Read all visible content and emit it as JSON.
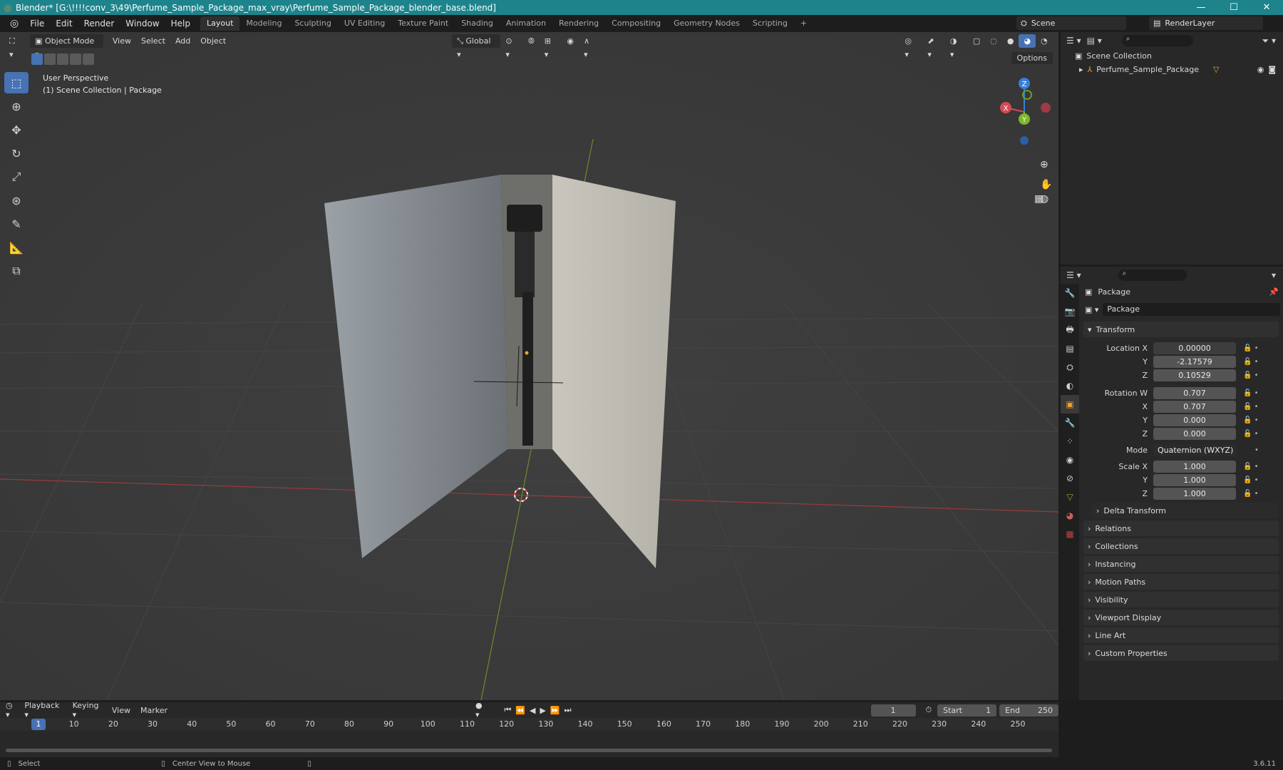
{
  "window": {
    "title": "Blender* [G:\\!!!!conv_3\\49\\Perfume_Sample_Package_max_vray\\Perfume_Sample_Package_blender_base.blend]",
    "min": "—",
    "max": "☐",
    "close": "✕"
  },
  "menu": [
    "File",
    "Edit",
    "Render",
    "Window",
    "Help"
  ],
  "workspaces": [
    "Layout",
    "Modeling",
    "Sculpting",
    "UV Editing",
    "Texture Paint",
    "Shading",
    "Animation",
    "Rendering",
    "Compositing",
    "Geometry Nodes",
    "Scripting",
    "+"
  ],
  "scene": {
    "name": "Scene",
    "view_layer": "RenderLayer"
  },
  "viewport": {
    "mode": "Object Mode",
    "menus": [
      "View",
      "Select",
      "Add",
      "Object"
    ],
    "orientation": "Global",
    "options": "Options",
    "info_line1": "User Perspective",
    "info_line2": "(1) Scene Collection | Package",
    "gizmo": {
      "x": "X",
      "y": "Y",
      "z": "Z"
    }
  },
  "outliner": {
    "root": "Scene Collection",
    "item": "Perfume_Sample_Package"
  },
  "properties": {
    "object_name": "Package",
    "data_name": "Package",
    "transform_label": "Transform",
    "location": {
      "label": "Location X",
      "x": "0.00000",
      "y": "-2.17579",
      "z": "0.10529"
    },
    "rotation": {
      "label": "Rotation W",
      "w": "0.707",
      "x": "0.707",
      "y": "0.000",
      "z": "0.000"
    },
    "mode_label": "Mode",
    "mode_value": "Quaternion (WXYZ)",
    "scale": {
      "label": "Scale X",
      "x": "1.000",
      "y": "1.000",
      "z": "1.000"
    },
    "axis_y": "Y",
    "axis_z": "Z",
    "axis_x": "X",
    "delta": "Delta Transform",
    "panels": [
      "Relations",
      "Collections",
      "Instancing",
      "Motion Paths",
      "Visibility",
      "Viewport Display",
      "Line Art",
      "Custom Properties"
    ]
  },
  "timeline": {
    "menus": [
      "Playback",
      "Keying",
      "View",
      "Marker"
    ],
    "current_frame": "1",
    "start_label": "Start",
    "start": "1",
    "end_label": "End",
    "end": "250",
    "ticks": [
      "1",
      "10",
      "20",
      "30",
      "40",
      "50",
      "60",
      "70",
      "80",
      "90",
      "100",
      "110",
      "120",
      "130",
      "140",
      "150",
      "160",
      "170",
      "180",
      "190",
      "200",
      "210",
      "220",
      "230",
      "240",
      "250"
    ]
  },
  "status": {
    "select": "Select",
    "center": "Center View to Mouse",
    "version": "3.6.11"
  }
}
